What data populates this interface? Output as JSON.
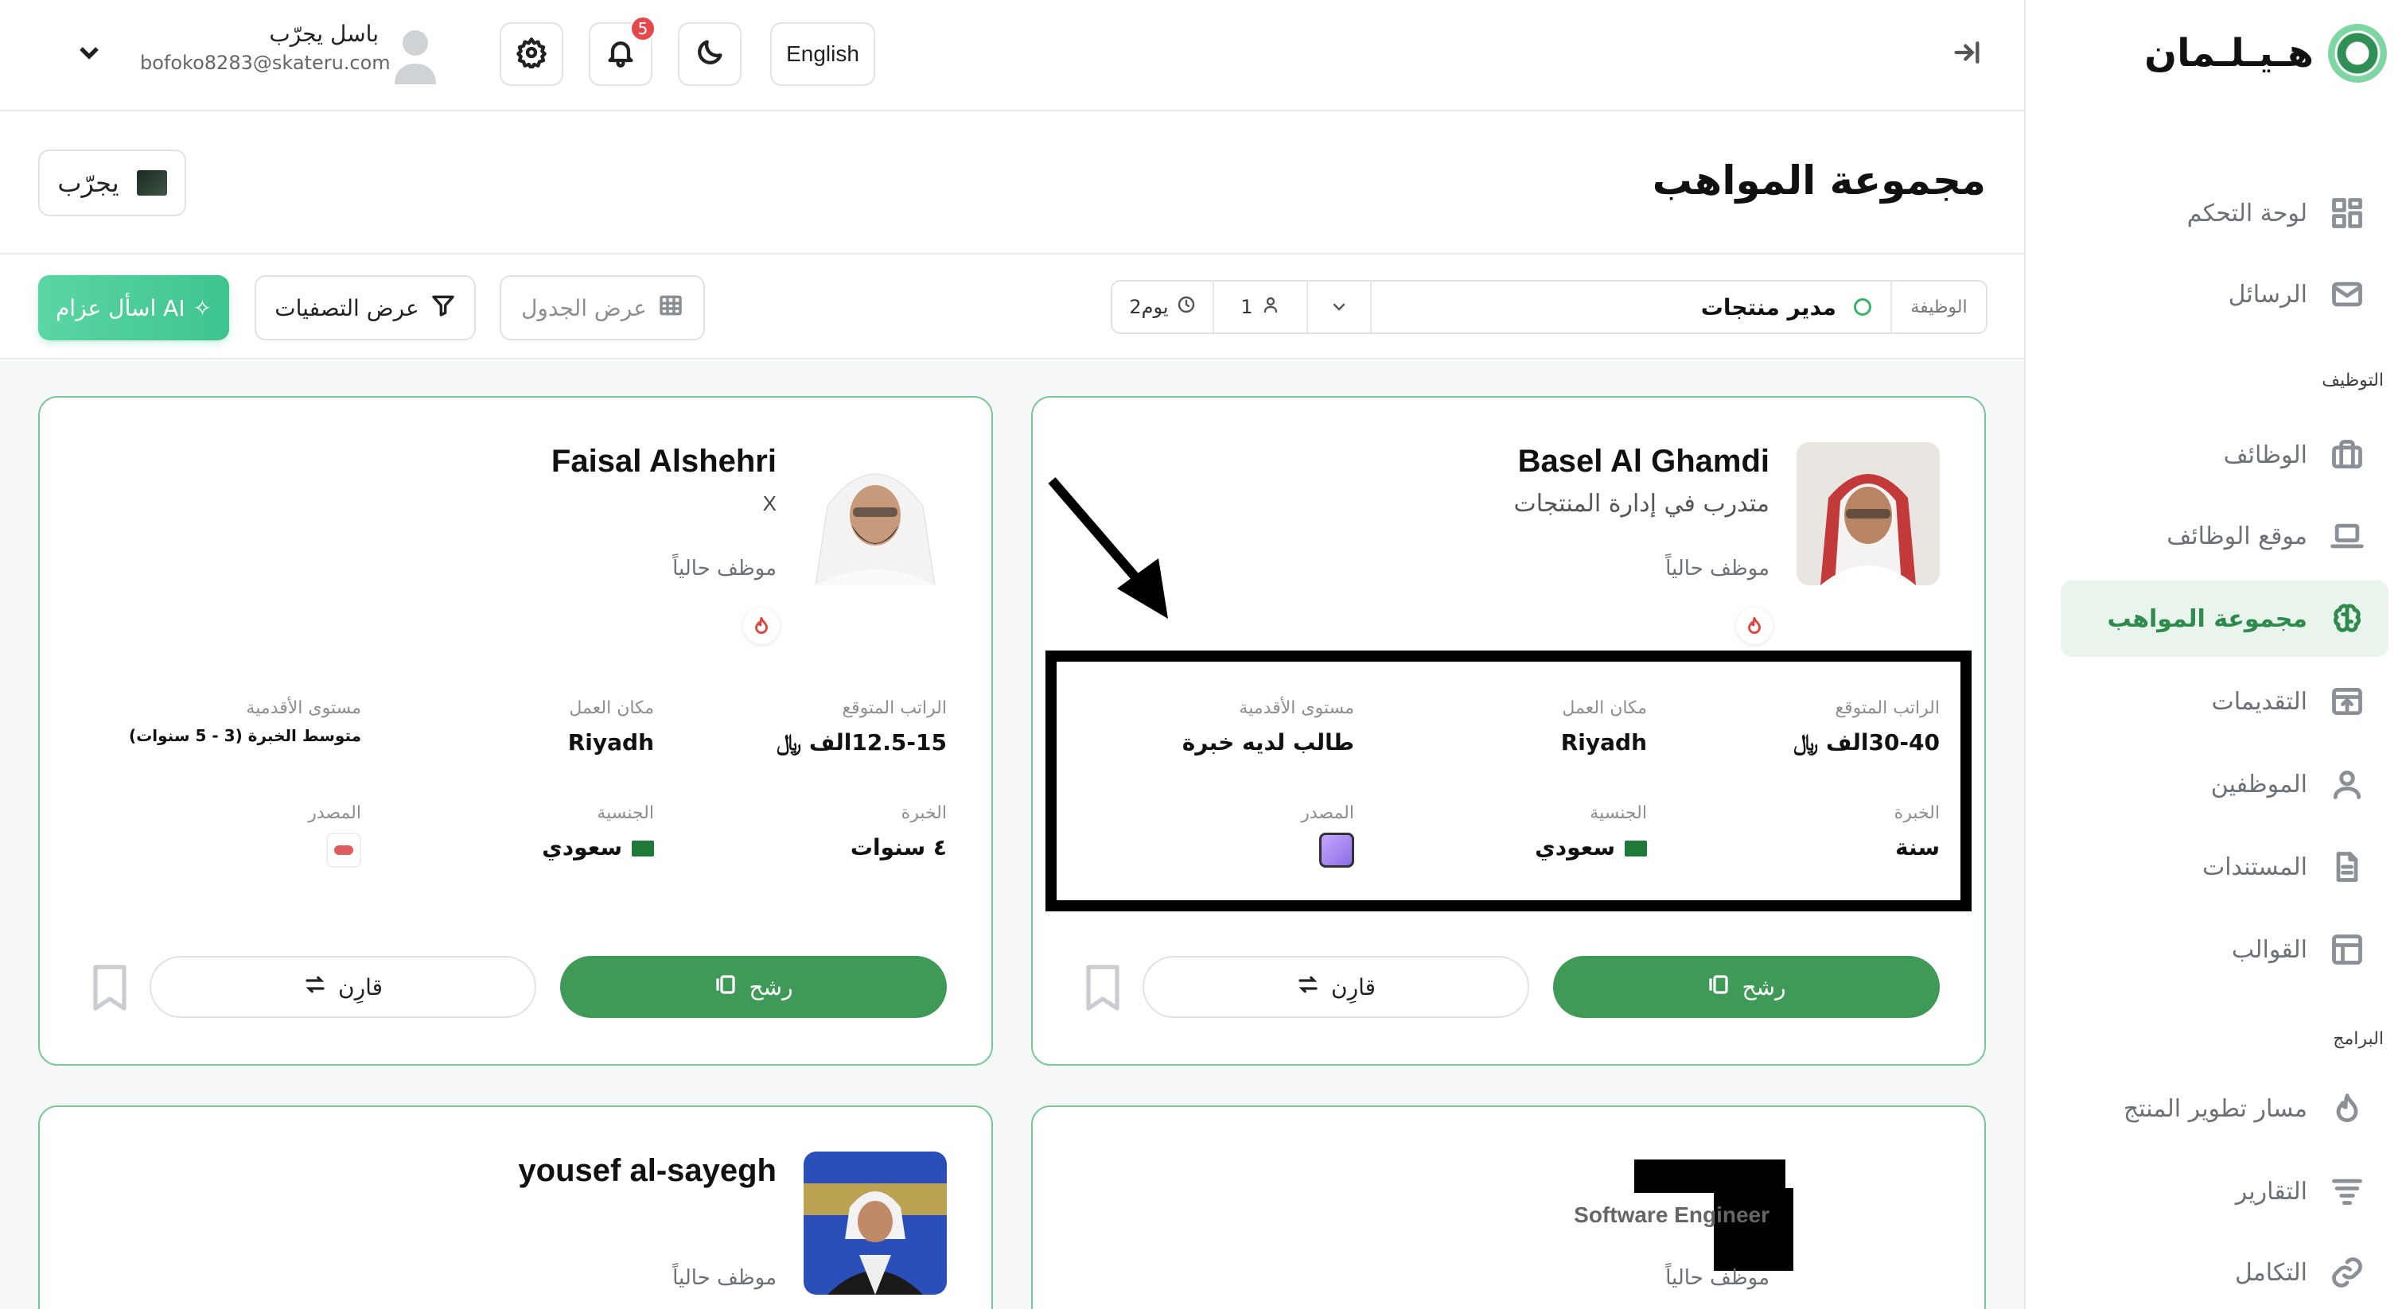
{
  "brand": {
    "logo_text": "هـيـلـمان"
  },
  "sidebar": {
    "items": [
      {
        "label": "لوحة التحكم",
        "icon": "dashboard-icon",
        "active": false
      },
      {
        "label": "الرسائل",
        "icon": "mail-icon",
        "active": false
      },
      {
        "label": "الوظائف",
        "icon": "briefcase-icon",
        "active": false
      },
      {
        "label": "موقع الوظائف",
        "icon": "laptop-icon",
        "active": false
      },
      {
        "label": "مجموعة المواهب",
        "icon": "brain-icon",
        "active": true
      },
      {
        "label": "التقديمات",
        "icon": "inbox-upload-icon",
        "active": false
      },
      {
        "label": "الموظفين",
        "icon": "user-icon",
        "active": false
      },
      {
        "label": "المستندات",
        "icon": "document-icon",
        "active": false
      },
      {
        "label": "القوالب",
        "icon": "template-icon",
        "active": false
      },
      {
        "label": "مسار تطوير المنتج",
        "icon": "flame-icon",
        "active": false
      },
      {
        "label": "التقارير",
        "icon": "report-icon",
        "active": false
      },
      {
        "label": "التكامل",
        "icon": "link-icon",
        "active": false
      }
    ],
    "section_hiring": "التوظيف",
    "section_programs": "البرامج"
  },
  "topbar": {
    "user_name": "باسل يجرّب",
    "user_email": "bofoko8283@skateru.com",
    "notifications_count": "5",
    "language_label": "English"
  },
  "page": {
    "title": "مجموعة المواهب",
    "company_name": "يجرّب"
  },
  "filters": {
    "ai_button": "اسأل عزام AI",
    "filters_button": "عرض التصفيات",
    "table_button": "عرض الجدول",
    "job_label": "الوظيفة",
    "job_title": "مدير منتجات",
    "applicants_count": "1",
    "days_label": "2يوم"
  },
  "labels": {
    "salary": "الراتب المتوقع",
    "location": "مكان العمل",
    "seniority": "مستوى الأقدمية",
    "experience": "الخبرة",
    "nationality": "الجنسية",
    "source": "المصدر",
    "nominate": "رشح",
    "compare": "قارِن",
    "status": "موظف حالياً"
  },
  "candidates": [
    {
      "name": "Basel Al Ghamdi",
      "role": "متدرب في إدارة المنتجات",
      "salary": "30-40الف",
      "location": "Riyadh",
      "seniority": "طالب لديه خبرة",
      "experience": "سنة",
      "nationality": "سعودي"
    },
    {
      "name": "Faisal Alshehri",
      "role": "X",
      "salary": "12.5-15الف",
      "location": "Riyadh",
      "seniority": "متوسط الخبرة (3 - 5 سنوات)",
      "experience": "٤ سنوات",
      "nationality": "سعودي"
    },
    {
      "name": "",
      "role": "Software Engineer"
    },
    {
      "name": "yousef al-sayegh",
      "role": ""
    }
  ],
  "colors": {
    "primary": "#3f9a58",
    "active_bg": "#e9f4ec",
    "card_border": "#7cc796",
    "badge": "#e5484d"
  }
}
